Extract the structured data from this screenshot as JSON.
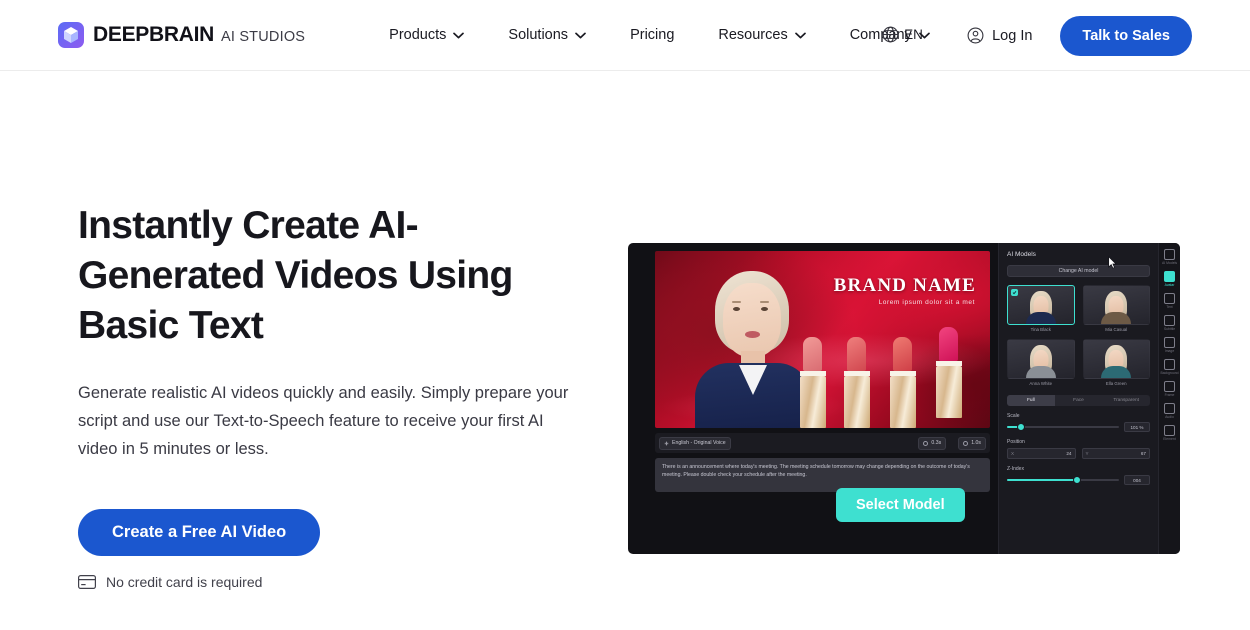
{
  "header": {
    "logo": {
      "main": "DEEPBRAIN",
      "sub": "AI STUDIOS",
      "icon": "cube-logo-icon"
    },
    "nav": [
      {
        "label": "Products",
        "has_chevron": true
      },
      {
        "label": "Solutions",
        "has_chevron": true
      },
      {
        "label": "Pricing",
        "has_chevron": false
      },
      {
        "label": "Resources",
        "has_chevron": true
      },
      {
        "label": "Company",
        "has_chevron": true
      }
    ],
    "language": {
      "label": "EN",
      "icon": "globe-icon"
    },
    "login": {
      "label": "Log In",
      "icon": "user-circle-icon"
    },
    "cta": {
      "label": "Talk to Sales",
      "color": "#1b57cf"
    }
  },
  "hero": {
    "title": "Instantly Create AI-Generated Videos Using Basic Text",
    "paragraph": "Generate realistic AI videos quickly and easily. Simply prepare your script and use our Text-to-Speech feature to receive your first AI video in 5 minutes or less.",
    "cta": {
      "label": "Create a Free AI Video",
      "color": "#1b57cf"
    },
    "note": {
      "label": "No credit card is required",
      "icon": "credit-card-icon"
    }
  },
  "app_mock": {
    "stage": {
      "brand_title": "BRAND NAME",
      "brand_sub": "Lorem ipsum dolor sit a met"
    },
    "toolbar": {
      "voice_chip": "English - Original Voice",
      "timing_chips": [
        "0.3s",
        "1.0s"
      ]
    },
    "script_text": "There is an announcement where today's meeting. The meeting schedule tomorrow may change depending on the outcome of today's meeting. Please double check your schedule after the meeting.",
    "select_model_button": "Select Model",
    "panel": {
      "title": "AI Models",
      "change_button": "Change AI model",
      "models": [
        {
          "name": "Tina Black",
          "selected": true
        },
        {
          "name": "Mia Casual",
          "selected": false
        },
        {
          "name": "Anna White",
          "selected": false
        },
        {
          "name": "Ella Green",
          "selected": false
        }
      ],
      "segments": [
        {
          "label": "Full",
          "active": true
        },
        {
          "label": "Face",
          "active": false
        },
        {
          "label": "Transparent",
          "active": false
        }
      ],
      "scale": {
        "label": "Scale",
        "value": "101 %",
        "percent": 12
      },
      "position": {
        "label": "Position",
        "x_axis": "X",
        "x_value": "24",
        "y_axis": "Y",
        "y_value": "67"
      },
      "z_index": {
        "label": "Z-Index",
        "value": "004",
        "percent": 62
      }
    },
    "rail": [
      {
        "name": "ai-models-icon",
        "label": "AI Models",
        "active": false
      },
      {
        "name": "avatar-icon",
        "label": "Avatar",
        "active": true
      },
      {
        "name": "text-icon",
        "label": "Text",
        "active": false
      },
      {
        "name": "subtitle-icon",
        "label": "Subtitle",
        "active": false
      },
      {
        "name": "image-icon",
        "label": "Image",
        "active": false
      },
      {
        "name": "background-icon",
        "label": "Background",
        "active": false
      },
      {
        "name": "frame-icon",
        "label": "Frame",
        "active": false
      },
      {
        "name": "audio-icon",
        "label": "Audio",
        "active": false
      },
      {
        "name": "element-icon",
        "label": "Element",
        "active": false
      }
    ],
    "accent_color": "#3ee0d0"
  }
}
